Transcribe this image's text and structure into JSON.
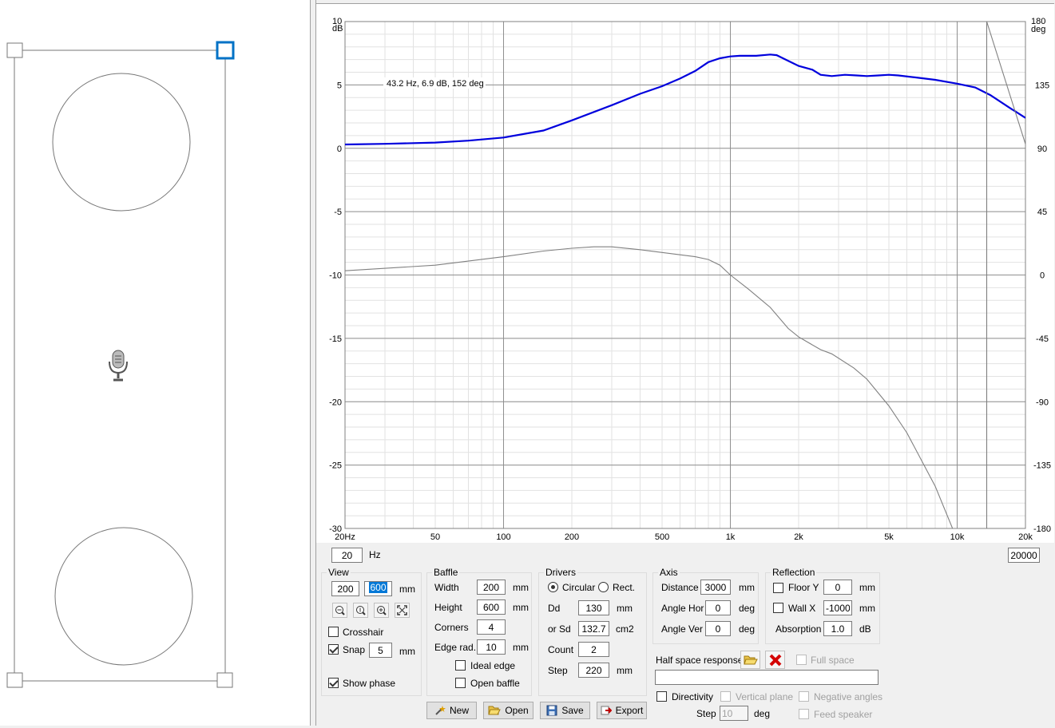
{
  "baffle_view": {
    "drivers": [
      {
        "name": "upper-driver"
      },
      {
        "name": "lower-driver"
      }
    ]
  },
  "chart": {
    "annotation": "43.2 Hz, 6.9 dB, 152 deg",
    "left_unit_top": "10",
    "left_unit": "dB",
    "right_unit_top": "180",
    "right_unit": "deg"
  },
  "chart_data": {
    "type": "line",
    "x_scale": "log",
    "xlim": [
      20,
      20000
    ],
    "ylim": [
      -30,
      10
    ],
    "y2lim": [
      -180,
      180
    ],
    "grid": true,
    "x_ticks": [
      "20Hz",
      "50",
      "100",
      "200",
      "500",
      "1k",
      "2k",
      "5k",
      "10k",
      "20k"
    ],
    "x_tick_values": [
      20,
      50,
      100,
      200,
      500,
      1000,
      2000,
      5000,
      10000,
      20000
    ],
    "y_ticks": [
      "10",
      "5",
      "0",
      "-5",
      "-10",
      "-15",
      "-20",
      "-25",
      "-30"
    ],
    "y_tick_values": [
      10,
      5,
      0,
      -5,
      -10,
      -15,
      -20,
      -25,
      -30
    ],
    "y2_ticks": [
      "180",
      "135",
      "90",
      "45",
      "0",
      "-45",
      "-90",
      "-135",
      "-180"
    ],
    "y2_tick_values": [
      180,
      135,
      90,
      45,
      0,
      -45,
      -90,
      -135,
      -180
    ],
    "series": [
      {
        "axis": "left",
        "color": "#0000dd",
        "x": [
          20,
          30,
          50,
          70,
          100,
          150,
          200,
          300,
          400,
          500,
          600,
          700,
          800,
          900,
          1000,
          1100,
          1300,
          1500,
          1600,
          1800,
          2000,
          2300,
          2500,
          2800,
          3200,
          3600,
          4000,
          4500,
          5000,
          5500,
          6500,
          8000,
          10000,
          12000,
          14000,
          17000,
          20000
        ],
        "values": [
          0.3,
          0.35,
          0.45,
          0.6,
          0.85,
          1.4,
          2.2,
          3.4,
          4.3,
          4.9,
          5.5,
          6.1,
          6.8,
          7.1,
          7.25,
          7.3,
          7.3,
          7.4,
          7.35,
          6.9,
          6.5,
          6.2,
          5.8,
          5.7,
          5.8,
          5.75,
          5.7,
          5.75,
          5.8,
          5.75,
          5.6,
          5.4,
          5.1,
          4.8,
          4.2,
          3.2,
          2.4
        ]
      },
      {
        "axis": "right",
        "color": "#808080",
        "x": [
          20,
          50,
          100,
          150,
          200,
          250,
          300,
          400,
          500,
          700,
          800,
          900,
          1000,
          1200,
          1500,
          1800,
          2000,
          2500,
          2800,
          3500,
          4000,
          5000,
          6000,
          8000,
          10000,
          12000,
          13500
        ],
        "values": [
          3,
          7,
          13,
          17,
          19,
          20,
          20,
          18,
          16,
          13,
          11,
          7,
          0,
          -10,
          -23,
          -38,
          -44,
          -53,
          -56,
          -66,
          -74,
          -93,
          -112,
          -150,
          -188,
          -232,
          -260
        ]
      },
      {
        "axis": "right",
        "color": "#808080",
        "x": [
          13500,
          13500,
          20000
        ],
        "values": [
          -180,
          180,
          93
        ]
      }
    ]
  },
  "range": {
    "min": "20",
    "min_unit": "Hz",
    "max": "20000"
  },
  "view": {
    "title": "View",
    "width": "200",
    "height": "600",
    "unit": "mm",
    "zoom_buttons": [
      "zoom-out-icon",
      "zoom-actual-icon",
      "zoom-in-icon",
      "zoom-fit-icon"
    ],
    "crosshair_label": "Crosshair",
    "crosshair_checked": false,
    "snap_label": "Snap",
    "snap_checked": true,
    "snap_value": "5",
    "snap_unit": "mm",
    "show_phase_label": "Show phase",
    "show_phase_checked": true
  },
  "baffle": {
    "title": "Baffle",
    "width_label": "Width",
    "width": "200",
    "width_unit": "mm",
    "height_label": "Height",
    "height": "600",
    "height_unit": "mm",
    "corners_label": "Corners",
    "corners": "4",
    "edge_label": "Edge rad.",
    "edge": "10",
    "edge_unit": "mm",
    "ideal_edge_label": "Ideal edge",
    "open_baffle_label": "Open baffle"
  },
  "drivers": {
    "title": "Drivers",
    "circular_label": "Circular",
    "rect_label": "Rect.",
    "dd_label": "Dd",
    "dd": "130",
    "dd_unit": "mm",
    "sd_label": "or Sd",
    "sd": "132.7",
    "sd_unit": "cm2",
    "count_label": "Count",
    "count": "2",
    "step_label": "Step",
    "step": "220",
    "step_unit": "mm"
  },
  "axis": {
    "title": "Axis",
    "distance_label": "Distance",
    "distance": "3000",
    "distance_unit": "mm",
    "angle_hor_label": "Angle Hor",
    "angle_hor": "0",
    "angle_hor_unit": "deg",
    "angle_ver_label": "Angle Ver",
    "angle_ver": "0",
    "angle_ver_unit": "deg"
  },
  "reflection": {
    "title": "Reflection",
    "floor_label": "Floor Y",
    "floor": "0",
    "floor_unit": "mm",
    "wall_label": "Wall X",
    "wall": "-1000",
    "wall_unit": "mm",
    "absorption_label": "Absorption",
    "absorption": "1.0",
    "absorption_unit": "dB"
  },
  "half_space": {
    "label": "Half space response",
    "full_space_label": "Full space",
    "file": ""
  },
  "directivity": {
    "label": "Directivity",
    "vertical_plane_label": "Vertical plane",
    "negative_angles_label": "Negative angles",
    "step_label": "Step",
    "step": "10",
    "step_unit": "deg",
    "feed_speaker_label": "Feed speaker"
  },
  "buttons": {
    "new": "New",
    "open": "Open",
    "save": "Save",
    "export": "Export"
  },
  "colors": {
    "selection_blue": "#0078d7",
    "response_blue": "#0000dd",
    "delete_red": "#d40000"
  }
}
